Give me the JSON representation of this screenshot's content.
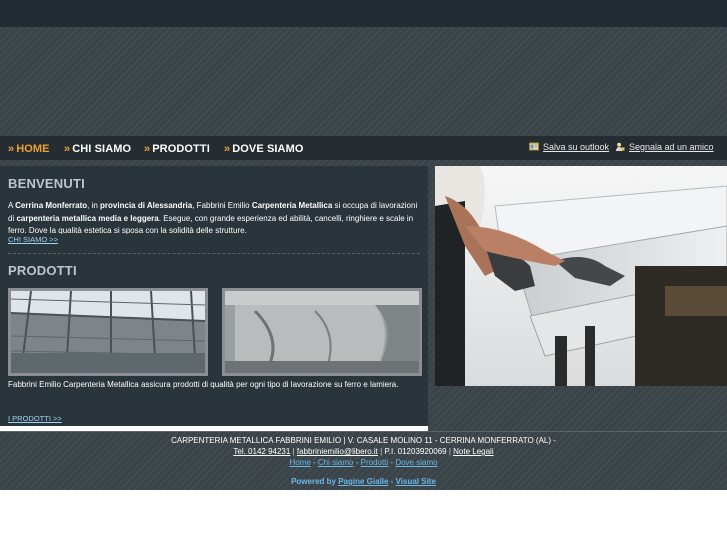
{
  "nav": {
    "items": [
      {
        "label": "HOME",
        "active": true
      },
      {
        "label": "CHI SIAMO"
      },
      {
        "label": "PRODOTTI"
      },
      {
        "label": "DOVE SIAMO"
      }
    ],
    "arrow": "»",
    "save_outlook": "Salva su outlook",
    "tell_friend": "Segnala ad un amico"
  },
  "welcome": {
    "title": "BENVENUTI",
    "parts": [
      "A ",
      "Cerrina Monferrato",
      ", in ",
      "provincia di Alessandria",
      ", Fabbrini Emilio ",
      "Carpenteria Metallica",
      " si occupa di lavorazioni di ",
      "carpenteria metallica media e leggera",
      ". Esegue, con grande esperienza ed abilità, cancelli, ringhiere e scale in ferro. Dove la qualità estetica si sposa con la solidità delle strutture."
    ],
    "link": "CHI SIAMO >>"
  },
  "products": {
    "title": "PRODOTTI",
    "text": "Fabbrini Emilio Carpenteria Metallica assicura prodotti di qualità per ogni tipo di lavorazione su ferro e lamiera.",
    "link": "I PRODOTTI >>"
  },
  "footer": {
    "line1": "CARPENTERIA METALLICA FABBRINI EMILIO | V. CASALE MOLINO 11 - CERRINA MONFERRATO (AL) -",
    "phone": "Tel. 0142 94231",
    "email": "fabbriniemilio@libero.it",
    "piva": "P.I. 01203920069",
    "legal": "Note Legali",
    "nav": [
      "Home",
      "Chi siamo",
      "Prodotti",
      "Dove siamo"
    ],
    "powered_prefix": "Powered by",
    "pagine_gialle": "Pagine Gialle",
    "visual_site": "Visual Site"
  },
  "colors": {
    "accent": "#f0a030",
    "link_blue": "#6ab8e8",
    "panel": "#29353b",
    "bar": "#252d33"
  },
  "icons": [
    "outlook-card-icon",
    "friend-person-icon"
  ]
}
